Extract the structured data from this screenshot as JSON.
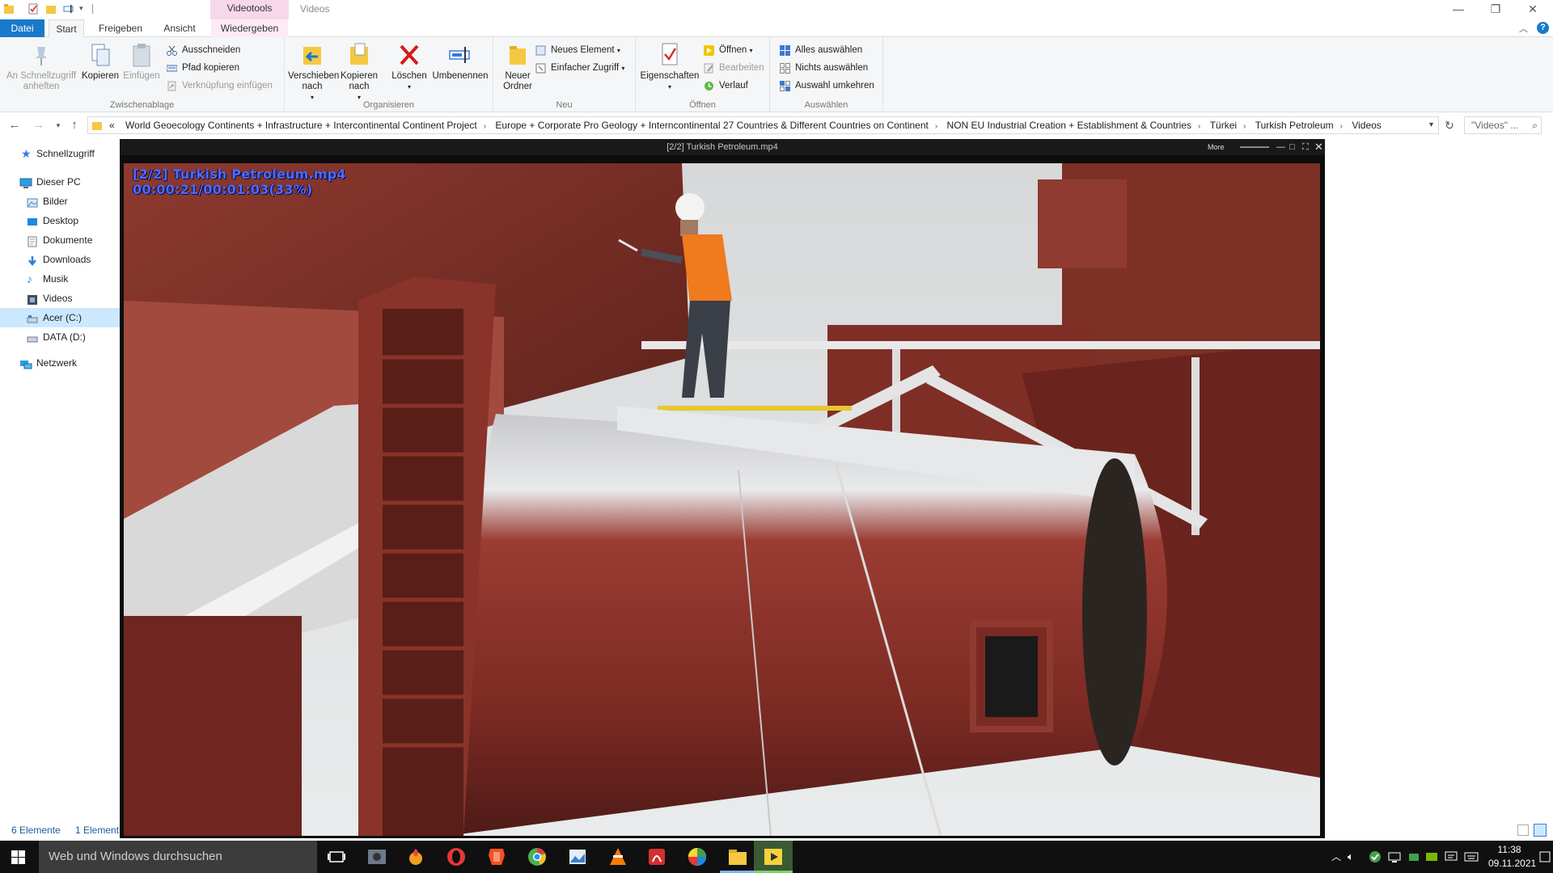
{
  "window": {
    "context_tab": "Videotools",
    "title": "Videos"
  },
  "tabs": {
    "datei": "Datei",
    "start": "Start",
    "freigeben": "Freigeben",
    "ansicht": "Ansicht",
    "wiedergeben": "Wiedergeben"
  },
  "ribbon": {
    "clipboard": {
      "pin": "An Schnellzugriff anheften",
      "copy": "Kopieren",
      "paste": "Einfügen",
      "cut": "Ausschneiden",
      "copy_path": "Pfad kopieren",
      "paste_shortcut": "Verknüpfung einfügen",
      "label": "Zwischenablage"
    },
    "organize": {
      "move_to": "Verschieben nach",
      "copy_to": "Kopieren nach",
      "delete": "Löschen",
      "rename": "Umbenennen",
      "label": "Organisieren"
    },
    "new": {
      "new_folder": "Neuer Ordner",
      "new_item": "Neues Element",
      "easy_access": "Einfacher Zugriff",
      "label": "Neu"
    },
    "open": {
      "properties": "Eigenschaften",
      "open": "Öffnen",
      "edit": "Bearbeiten",
      "history": "Verlauf",
      "label": "Öffnen"
    },
    "select": {
      "select_all": "Alles auswählen",
      "select_none": "Nichts auswählen",
      "invert": "Auswahl umkehren",
      "label": "Auswählen"
    }
  },
  "address": {
    "prefix": "«",
    "crumbs": [
      "World Geoecology Continents + Infrastructure + Intercontinental Continent Project",
      "Europe  + Corporate Pro Geology + Interncontinental 27 Countries & Different Countries on Continent",
      "NON EU Industrial Creation + Establishment & Countries",
      "Türkei",
      "Turkish Petroleum",
      "Videos"
    ],
    "search_placeholder": "\"Videos\" ..."
  },
  "nav": {
    "quick_access": "Schnellzugriff",
    "this_pc": "Dieser PC",
    "items": [
      "Bilder",
      "Desktop",
      "Dokumente",
      "Downloads",
      "Musik",
      "Videos",
      "Acer (C:)",
      "DATA (D:)"
    ],
    "network": "Netzwerk"
  },
  "status": {
    "count": "6 Elemente",
    "selected": "1 Element"
  },
  "player": {
    "title": "[2/2] Turkish Petroleum.mp4",
    "more": "More",
    "osd_file": "[2/2] Turkish Petroleum.mp4",
    "osd_time": "00:00:21/00:01:03(33%)",
    "progress": 0.33
  },
  "taskbar": {
    "search_placeholder": "Web und Windows durchsuchen",
    "time": "11:38",
    "date": "09.11.2021"
  },
  "colors": {
    "accent": "#1979ca",
    "context_tab": "#f7d7ea",
    "osd": "#4c6cff",
    "nav_selected": "#cce8ff"
  }
}
